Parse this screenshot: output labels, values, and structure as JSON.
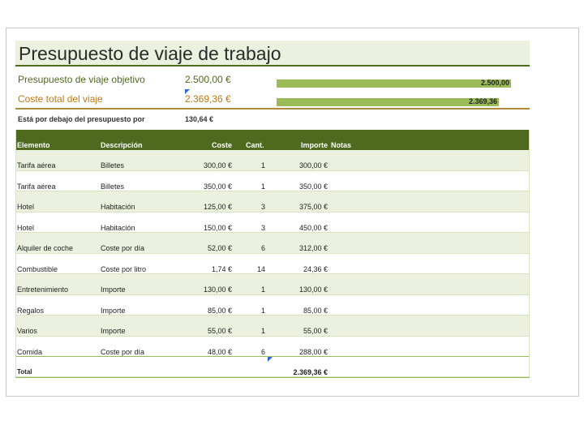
{
  "title": "Presupuesto de viaje de trabajo",
  "summary": {
    "target_label": "Presupuesto de viaje objetivo",
    "target_value": "2.500,00 €",
    "target_bar_label": "2.500,00",
    "target_bar_amount": 2500,
    "total_label": "Coste total del viaje",
    "total_value": "2.369,36 €",
    "total_bar_label": "2.369,36",
    "total_bar_amount": 2369.36,
    "under_label": "Está por debajo del presupuesto por",
    "under_value": "130,64 €"
  },
  "colors": {
    "header_green": "#4e6a1f",
    "light_green": "#ebf1de",
    "bar_green": "#9bbb59",
    "total_orange": "#c07a12"
  },
  "table": {
    "headers": {
      "element": "Elemento",
      "description": "Descripción",
      "cost": "Coste",
      "qty": "Cant.",
      "amount": "Importe",
      "notes": "Notas"
    },
    "rows": [
      {
        "element": "Tarifa aérea",
        "description": "Billetes",
        "cost": "300,00 €",
        "qty": "1",
        "amount": "300,00 €"
      },
      {
        "element": "Tarifa aérea",
        "description": "Billetes",
        "cost": "350,00 €",
        "qty": "1",
        "amount": "350,00 €"
      },
      {
        "element": "Hotel",
        "description": "Habitación",
        "cost": "125,00 €",
        "qty": "3",
        "amount": "375,00 €"
      },
      {
        "element": "Hotel",
        "description": "Habitación",
        "cost": "150,00 €",
        "qty": "3",
        "amount": "450,00 €"
      },
      {
        "element": "Alquiler de coche",
        "description": "Coste por día",
        "cost": "52,00 €",
        "qty": "6",
        "amount": "312,00 €"
      },
      {
        "element": "Combustible",
        "description": "Coste por litro",
        "cost": "1,74 €",
        "qty": "14",
        "amount": "24,36 €"
      },
      {
        "element": "Entretenimiento",
        "description": "Importe",
        "cost": "130,00 €",
        "qty": "1",
        "amount": "130,00 €"
      },
      {
        "element": "Regalos",
        "description": "Importe",
        "cost": "85,00 €",
        "qty": "1",
        "amount": "85,00 €"
      },
      {
        "element": "Varios",
        "description": "Importe",
        "cost": "55,00 €",
        "qty": "1",
        "amount": "55,00 €"
      },
      {
        "element": "Comida",
        "description": "Coste por día",
        "cost": "48,00 €",
        "qty": "6",
        "amount": "288,00 €"
      }
    ],
    "total_label": "Total",
    "total_amount": "2.369,36 €"
  }
}
